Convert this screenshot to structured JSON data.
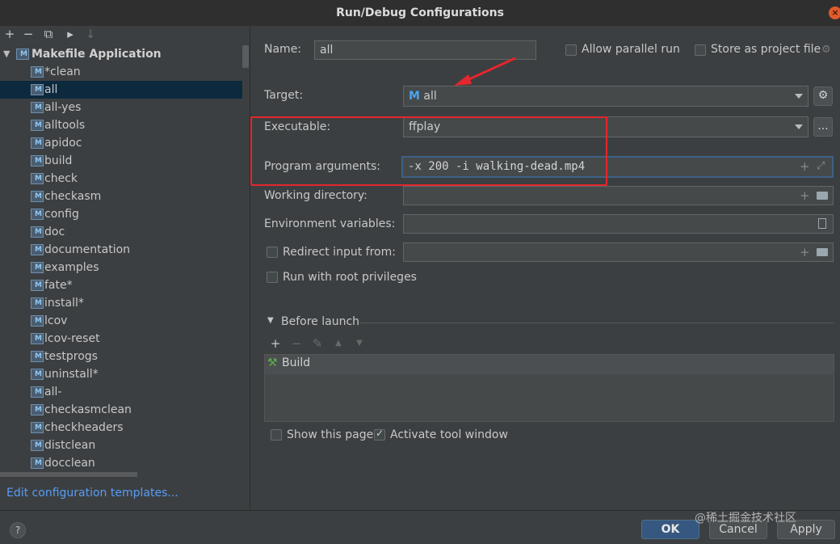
{
  "window": {
    "title": "Run/Debug Configurations"
  },
  "tree": {
    "group_label": "Makefile Application",
    "items": [
      {
        "label": "*clean"
      },
      {
        "label": "all"
      },
      {
        "label": "all-yes"
      },
      {
        "label": "alltools"
      },
      {
        "label": "apidoc"
      },
      {
        "label": "build"
      },
      {
        "label": "check"
      },
      {
        "label": "checkasm"
      },
      {
        "label": "config"
      },
      {
        "label": "doc"
      },
      {
        "label": "documentation"
      },
      {
        "label": "examples"
      },
      {
        "label": "fate*"
      },
      {
        "label": "install*"
      },
      {
        "label": "lcov"
      },
      {
        "label": "lcov-reset"
      },
      {
        "label": "testprogs"
      },
      {
        "label": "uninstall*"
      },
      {
        "label": "all-"
      },
      {
        "label": "checkasmclean"
      },
      {
        "label": "checkheaders"
      },
      {
        "label": "distclean"
      },
      {
        "label": "docclean"
      }
    ],
    "selected": "all",
    "edit_templates_link": "Edit configuration templates..."
  },
  "form": {
    "name_label": "Name:",
    "name_value": "all",
    "allow_parallel_label": "Allow parallel run",
    "store_as_project_label": "Store as project file",
    "target_label": "Target:",
    "target_value": "all",
    "target_icon_letter": "M",
    "executable_label": "Executable:",
    "executable_value": "ffplay",
    "program_args_label": "Program arguments:",
    "program_args_value": "-x 200 -i walking-dead.mp4",
    "working_dir_label": "Working directory:",
    "working_dir_value": "",
    "env_vars_label": "Environment variables:",
    "env_vars_value": "",
    "redirect_input_label": "Redirect input from:",
    "redirect_input_value": "",
    "run_root_label": "Run with root privileges",
    "browse_button_label": "...",
    "before_launch_label": "Before launch",
    "before_launch_items": [
      {
        "label": "Build"
      }
    ],
    "show_page_label": "Show this page",
    "activate_tool_label": "Activate tool window"
  },
  "state": {
    "allow_parallel_checked": false,
    "store_as_project_checked": false,
    "redirect_input_checked": false,
    "run_root_checked": false,
    "show_page_checked": false,
    "activate_tool_checked": true
  },
  "footer": {
    "help_label": "?",
    "ok_label": "OK",
    "cancel_label": "Cancel",
    "apply_label": "Apply",
    "watermark": "@稀土掘金技术社区"
  },
  "colors": {
    "background": "#3c3f41",
    "selection": "#0d293e",
    "annotation_red": "#e5262e",
    "link_blue": "#589df6",
    "primary_button": "#365880"
  }
}
